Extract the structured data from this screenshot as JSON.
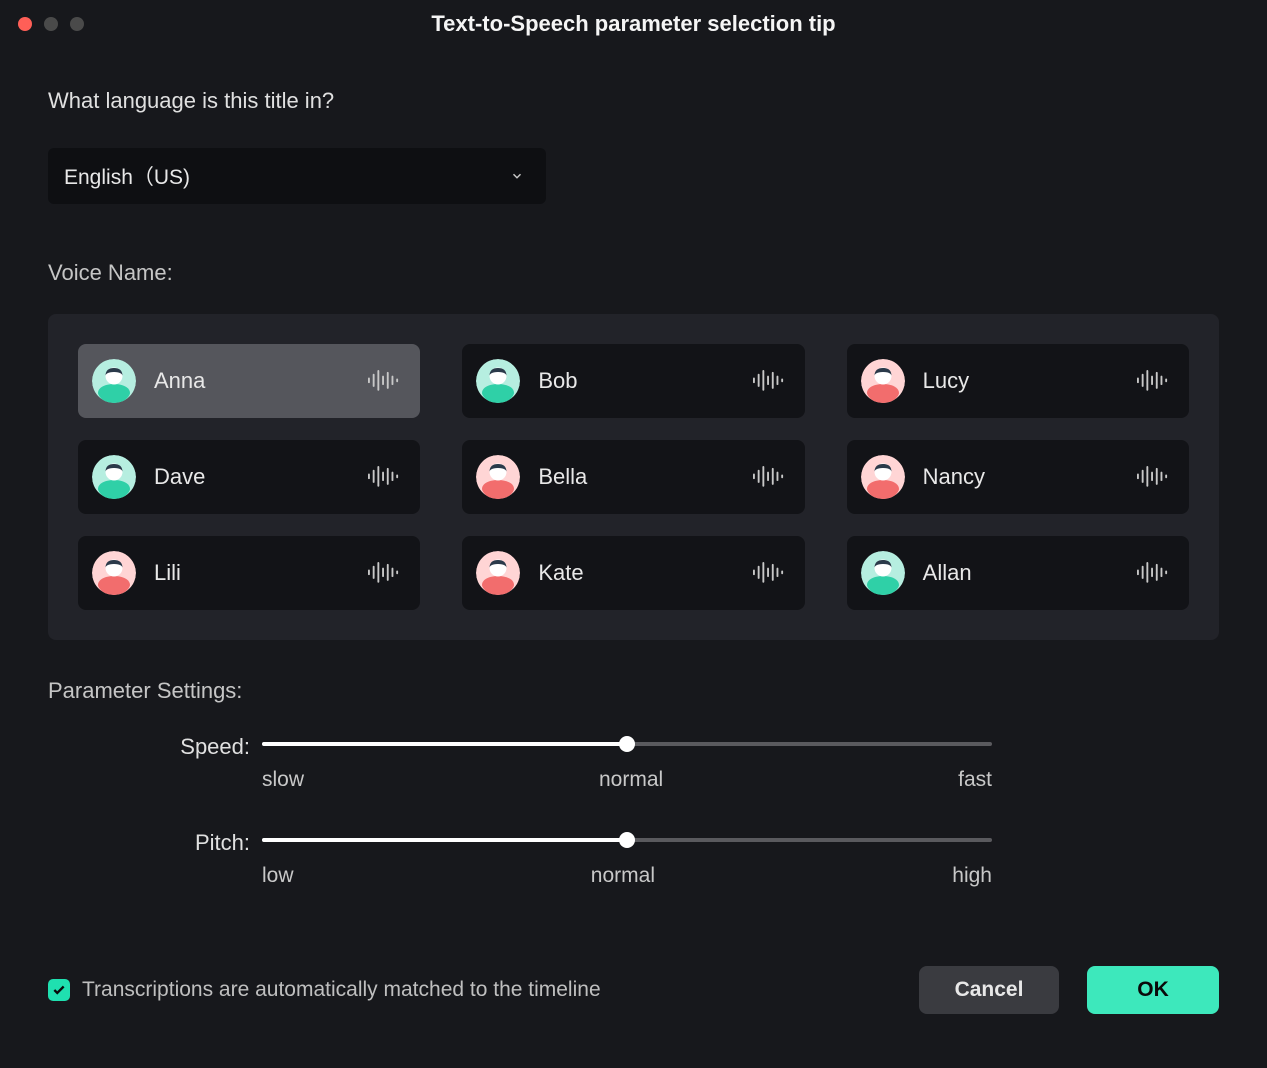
{
  "title": "Text-to-Speech parameter selection tip",
  "question": "What language is this title in?",
  "language_selected": "English（US)",
  "voice_name_label": "Voice Name:",
  "voices": [
    {
      "name": "Anna",
      "avatar_color": "teal",
      "selected": true
    },
    {
      "name": "Bob",
      "avatar_color": "teal",
      "selected": false
    },
    {
      "name": "Lucy",
      "avatar_color": "pink",
      "selected": false
    },
    {
      "name": "Dave",
      "avatar_color": "teal",
      "selected": false
    },
    {
      "name": "Bella",
      "avatar_color": "pink",
      "selected": false
    },
    {
      "name": "Nancy",
      "avatar_color": "pink",
      "selected": false
    },
    {
      "name": "Lili",
      "avatar_color": "pink",
      "selected": false
    },
    {
      "name": "Kate",
      "avatar_color": "pink",
      "selected": false
    },
    {
      "name": "Allan",
      "avatar_color": "teal",
      "selected": false
    }
  ],
  "parameter_settings_label": "Parameter Settings:",
  "sliders": {
    "speed": {
      "label": "Speed:",
      "value": 50,
      "marks": [
        "slow",
        "normal",
        "fast"
      ]
    },
    "pitch": {
      "label": "Pitch:",
      "value": 50,
      "marks": [
        "low",
        "normal",
        "high"
      ]
    }
  },
  "checkbox": {
    "checked": true,
    "label": "Transcriptions are automatically matched to the timeline"
  },
  "buttons": {
    "cancel": "Cancel",
    "ok": "OK"
  }
}
